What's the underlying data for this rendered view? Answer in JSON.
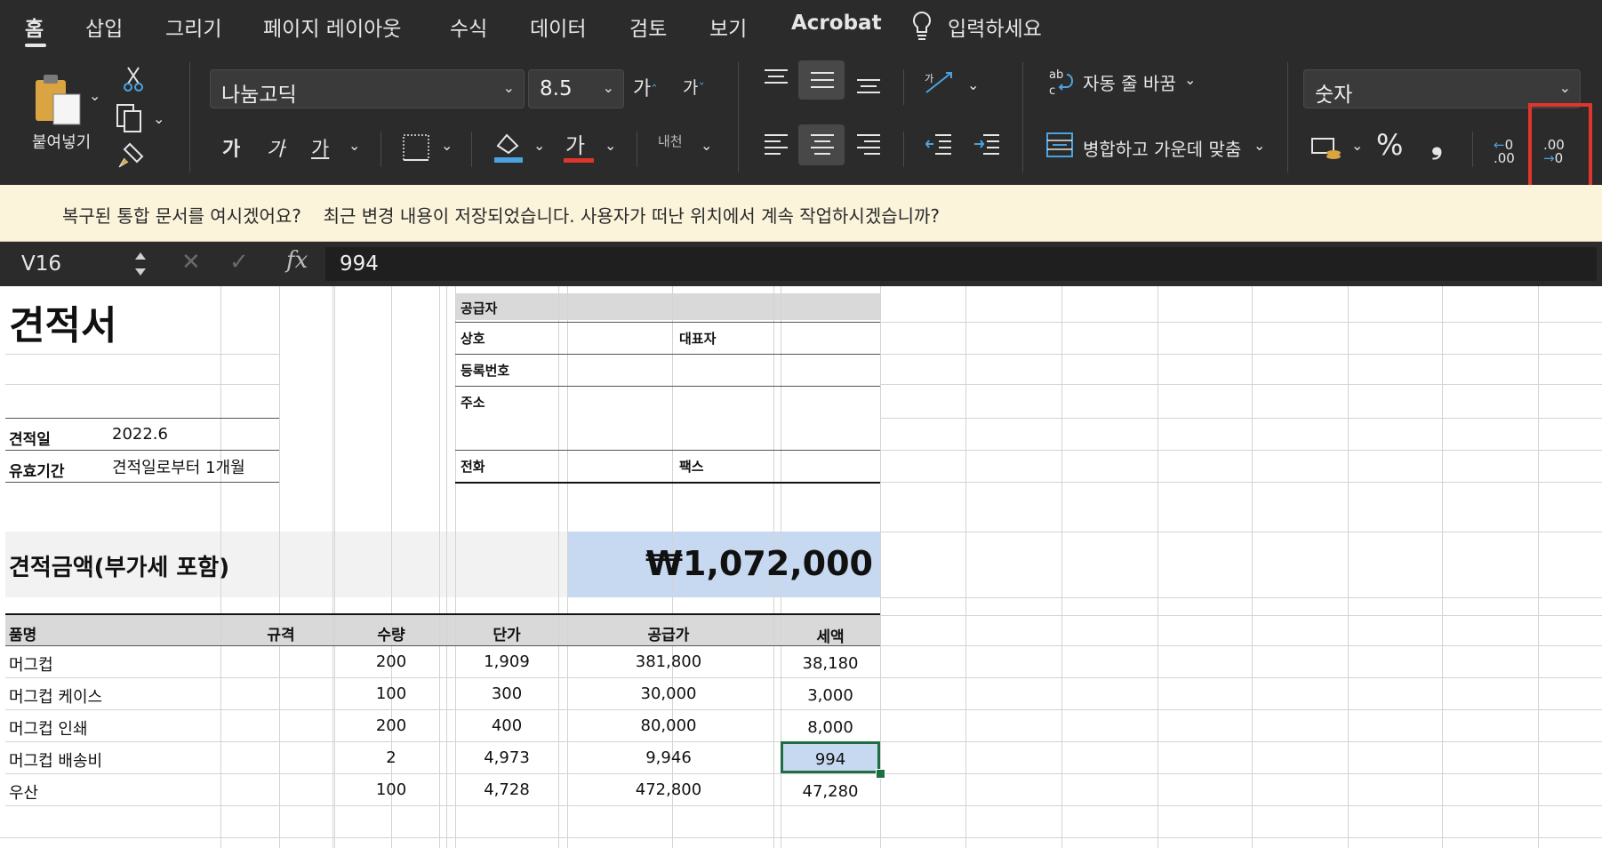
{
  "tabs": [
    "홈",
    "삽입",
    "그리기",
    "페이지 레이아웃",
    "수식",
    "데이터",
    "검토",
    "보기",
    "Acrobat"
  ],
  "tell_me": "입력하세요",
  "ribbon": {
    "paste_label": "붙여넣기",
    "font_name": "나눔고딕",
    "font_size": "8.5",
    "grow_font": "가",
    "shrink_font": "가",
    "bold": "가",
    "italic": "가",
    "underline": "가",
    "font_color_glyph": "가",
    "phonetic": "내천",
    "wrap_text": "자동 줄 바꿈",
    "merge_center": "병합하고 가운데 맞춤",
    "number_format": "숫자",
    "percent": "%",
    "comma": "❟",
    "inc_decimal": ".00",
    "dec_decimal": ".00",
    "colors": {
      "font_red": "#e0352b",
      "fill_blue": "#4aa3df",
      "highlight": "#e0352b"
    }
  },
  "notification": {
    "title": "복구된 통합 문서를 여시겠어요?",
    "message": "최근 변경 내용이 저장되었습니다. 사용자가 떠난 위치에서 계속 작업하시겠습니까?"
  },
  "formula_bar": {
    "cell_ref": "V16",
    "value": "994",
    "fx": "fx"
  },
  "sheet": {
    "title": "견적서",
    "quote_date_label": "견적일",
    "quote_date": "2022.6",
    "validity_label": "유효기간",
    "validity": "견적일로부터 1개월",
    "supplier": {
      "header": "공급자",
      "company": "상호",
      "ceo": "대표자",
      "reg_no": "등록번호",
      "address": "주소",
      "phone": "전화",
      "fax": "팩스"
    },
    "total_label": "견적금액(부가세 포함)",
    "total_value": "₩1,072,000",
    "columns": [
      "품명",
      "규격",
      "수량",
      "단가",
      "공급가",
      "세액"
    ],
    "rows": [
      [
        "머그컵",
        "",
        "200",
        "1,909",
        "381,800",
        "38,180"
      ],
      [
        "머그컵 케이스",
        "",
        "100",
        "300",
        "30,000",
        "3,000"
      ],
      [
        "머그컵 인쇄",
        "",
        "200",
        "400",
        "80,000",
        "8,000"
      ],
      [
        "머그컵 배송비",
        "",
        "2",
        "4,973",
        "9,946",
        "994"
      ],
      [
        "우산",
        "",
        "100",
        "4,728",
        "472,800",
        "47,280"
      ]
    ]
  }
}
